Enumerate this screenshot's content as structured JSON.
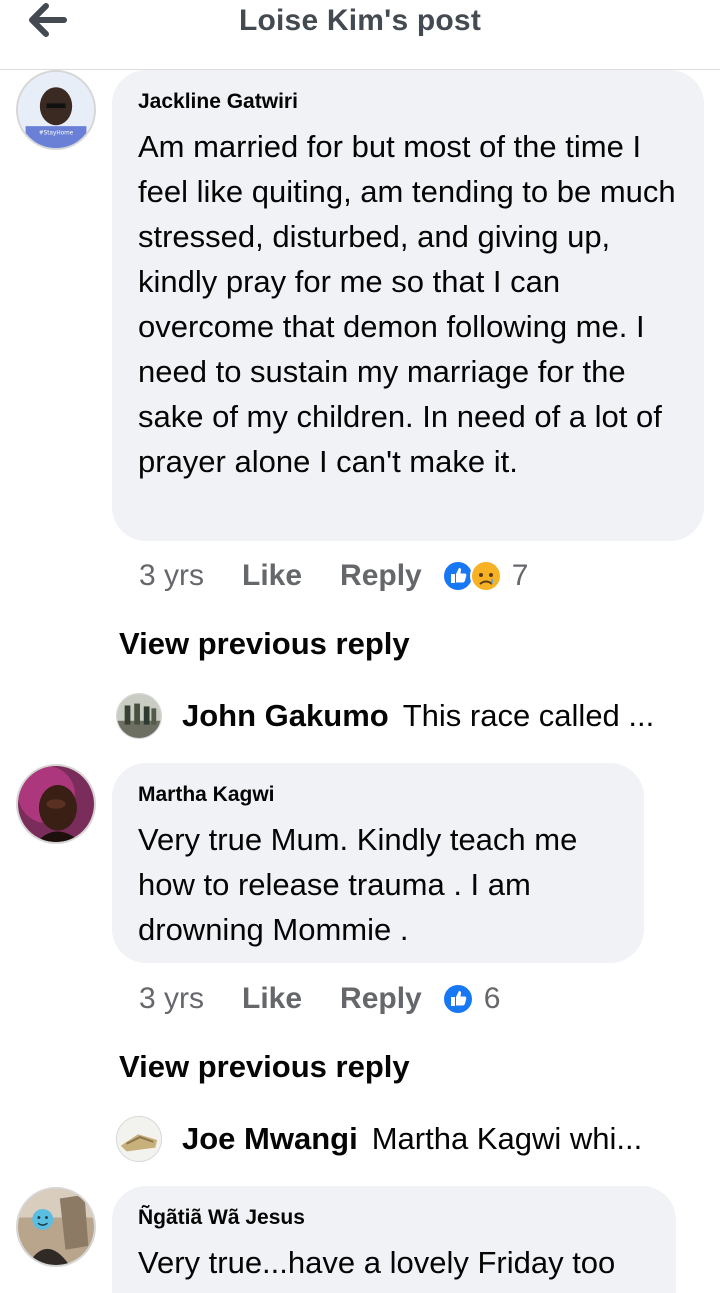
{
  "header": {
    "title": "Loise Kim's post",
    "back_icon": "arrow-left-icon"
  },
  "comments": [
    {
      "author": "Jackline Gatwiri",
      "text": "Am married for but most of the time I feel like quiting, am tending to be much stressed, disturbed, and giving up, kindly pray for me so that I can overcome that demon following me. I need to sustain my marriage for the sake of my children. In need of a lot of prayer alone I can't make it.",
      "avatar_caption": "#StayHome",
      "time": "3 yrs",
      "like_label": "Like",
      "reply_label": "Reply",
      "reactions": [
        "like-reaction-icon",
        "sad-reaction-icon"
      ],
      "reaction_count": "7",
      "view_previous": "View previous reply",
      "reply_preview": {
        "name": "John Gakumo",
        "text": "This race called ..."
      }
    },
    {
      "author": "Martha Kagwi",
      "text": "Very true Mum. Kindly teach me how to release trauma . I am drowning Mommie .",
      "time": "3 yrs",
      "like_label": "Like",
      "reply_label": "Reply",
      "reactions": [
        "like-reaction-icon"
      ],
      "reaction_count": "6",
      "view_previous": "View previous reply",
      "reply_preview": {
        "name": "Joe Mwangi",
        "text": "Martha Kagwi whi..."
      }
    },
    {
      "author": "Ñgãtiã Wã Jesus",
      "text": "Very true...have a lovely Friday too"
    }
  ],
  "colors": {
    "like_blue": "#1877f2",
    "sad_yellow": "#f7b125",
    "meta_gray": "#65676b",
    "bubble_bg": "#f0f2f5"
  }
}
